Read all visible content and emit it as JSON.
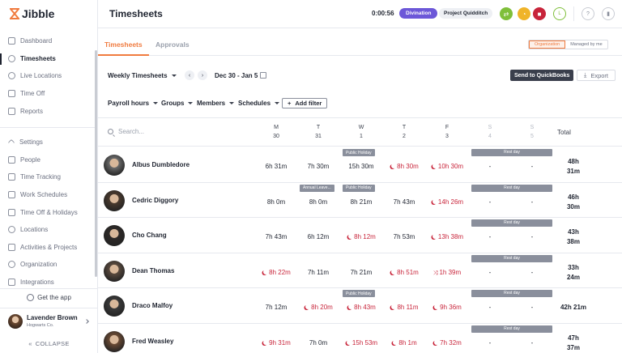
{
  "app": {
    "logo_text": "Jibble",
    "accent": "#f07b3f"
  },
  "sidebar": {
    "items": [
      {
        "label": "Dashboard",
        "icon": "dashboard-icon",
        "active": false
      },
      {
        "label": "Timesheets",
        "icon": "clock-icon",
        "active": true
      },
      {
        "label": "Live Locations",
        "icon": "location-icon",
        "active": false
      },
      {
        "label": "Time Off",
        "icon": "calendar-icon",
        "active": false
      },
      {
        "label": "Reports",
        "icon": "report-icon",
        "active": false
      }
    ],
    "settings_items": [
      {
        "label": "Settings",
        "icon": "chevron-up-icon"
      },
      {
        "label": "People",
        "icon": "people-icon"
      },
      {
        "label": "Time Tracking",
        "icon": "time-tracking-icon"
      },
      {
        "label": "Work Schedules",
        "icon": "schedule-icon"
      },
      {
        "label": "Time Off & Holidays",
        "icon": "holiday-icon"
      },
      {
        "label": "Locations",
        "icon": "pin-icon"
      },
      {
        "label": "Activities & Projects",
        "icon": "tag-icon"
      },
      {
        "label": "Organization",
        "icon": "gear-icon"
      },
      {
        "label": "Integrations",
        "icon": "plug-icon"
      }
    ],
    "get_app": "Get the app",
    "user": {
      "name": "Lavender Brown",
      "org": "Hogwarts Co."
    },
    "collapse": "COLLAPSE"
  },
  "header": {
    "title": "Timesheets",
    "timer": "0:00:56",
    "activity": "Divination",
    "project": "Project Quidditch",
    "user_initials": "L"
  },
  "tabs": {
    "items": [
      "Timesheets",
      "Approvals"
    ],
    "scope": [
      "Organization",
      "Managed by me"
    ]
  },
  "toolbar": {
    "view": "Weekly Timesheets",
    "date_range": "Dec 30 - Jan 5",
    "quickbooks": "Send to QuickBooks",
    "export": "Export"
  },
  "filters": {
    "items": [
      "Payroll hours",
      "Groups",
      "Members",
      "Schedules"
    ],
    "add_filter": "Add filter"
  },
  "table": {
    "search_placeholder": "Search...",
    "days": [
      {
        "d": "M",
        "n": "30",
        "off": false
      },
      {
        "d": "T",
        "n": "31",
        "off": false
      },
      {
        "d": "W",
        "n": "1",
        "off": false
      },
      {
        "d": "T",
        "n": "2",
        "off": false
      },
      {
        "d": "F",
        "n": "3",
        "off": false
      },
      {
        "d": "S",
        "n": "4",
        "off": true
      },
      {
        "d": "S",
        "n": "5",
        "off": true
      }
    ],
    "total_label": "Total",
    "rest_day": "Rest day",
    "rows": [
      {
        "name": "Albus Dumbledore",
        "avatar": "#6b6b6b",
        "cells": [
          [
            "6h 31m",
            ""
          ],
          [
            "7h 30m",
            ""
          ],
          [
            "15h 30m",
            ""
          ],
          [
            "8h 30m",
            "moon"
          ],
          [
            "10h 30m",
            "moon"
          ],
          [
            "-",
            ""
          ],
          [
            "-",
            ""
          ]
        ],
        "tags": [
          {
            "col": 2,
            "text": "Public Holiday"
          }
        ],
        "total": [
          "48h",
          "31m"
        ]
      },
      {
        "name": "Cedric Diggory",
        "avatar": "#4a3a2e",
        "cells": [
          [
            "8h 0m",
            ""
          ],
          [
            "8h 0m",
            ""
          ],
          [
            "8h 21m",
            ""
          ],
          [
            "7h 43m",
            ""
          ],
          [
            "14h 26m",
            "moon"
          ],
          [
            "-",
            ""
          ],
          [
            "-",
            ""
          ]
        ],
        "tags": [
          {
            "col": 1,
            "text": "Annual Leave..."
          },
          {
            "col": 2,
            "text": "Public Holiday"
          }
        ],
        "total": [
          "46h",
          "30m"
        ]
      },
      {
        "name": "Cho Chang",
        "avatar": "#2e2a28",
        "cells": [
          [
            "7h 43m",
            ""
          ],
          [
            "6h 12m",
            ""
          ],
          [
            "8h 12m",
            "moon"
          ],
          [
            "7h 53m",
            ""
          ],
          [
            "13h 38m",
            "moon"
          ],
          [
            "-",
            ""
          ],
          [
            "-",
            ""
          ]
        ],
        "tags": [],
        "total": [
          "43h",
          "38m"
        ]
      },
      {
        "name": "Dean Thomas",
        "avatar": "#5a4a3e",
        "cells": [
          [
            "8h 22m",
            "moon"
          ],
          [
            "7h 11m",
            ""
          ],
          [
            "7h 21m",
            ""
          ],
          [
            "8h 51m",
            "moon"
          ],
          [
            "1h 39m",
            "cross"
          ],
          [
            "-",
            ""
          ],
          [
            "-",
            ""
          ]
        ],
        "tags": [],
        "total": [
          "33h",
          "24m"
        ]
      },
      {
        "name": "Draco Malfoy",
        "avatar": "#3a3a3a",
        "cells": [
          [
            "7h 12m",
            ""
          ],
          [
            "8h 20m",
            "moon"
          ],
          [
            "8h 43m",
            "moon"
          ],
          [
            "8h 11m",
            "moon"
          ],
          [
            "9h 36m",
            "moon"
          ],
          [
            "-",
            ""
          ],
          [
            "-",
            ""
          ]
        ],
        "tags": [
          {
            "col": 2,
            "text": "Public Holiday"
          }
        ],
        "total": [
          "42h 21m"
        ]
      },
      {
        "name": "Fred Weasley",
        "avatar": "#6a4a34",
        "cells": [
          [
            "9h 31m",
            "moon"
          ],
          [
            "7h 0m",
            ""
          ],
          [
            "15h 53m",
            "moon"
          ],
          [
            "8h 1m",
            "moon"
          ],
          [
            "7h 32m",
            "moon"
          ],
          [
            "-",
            ""
          ],
          [
            "-",
            ""
          ]
        ],
        "tags": [],
        "total": [
          "47h",
          "37m"
        ]
      }
    ]
  }
}
